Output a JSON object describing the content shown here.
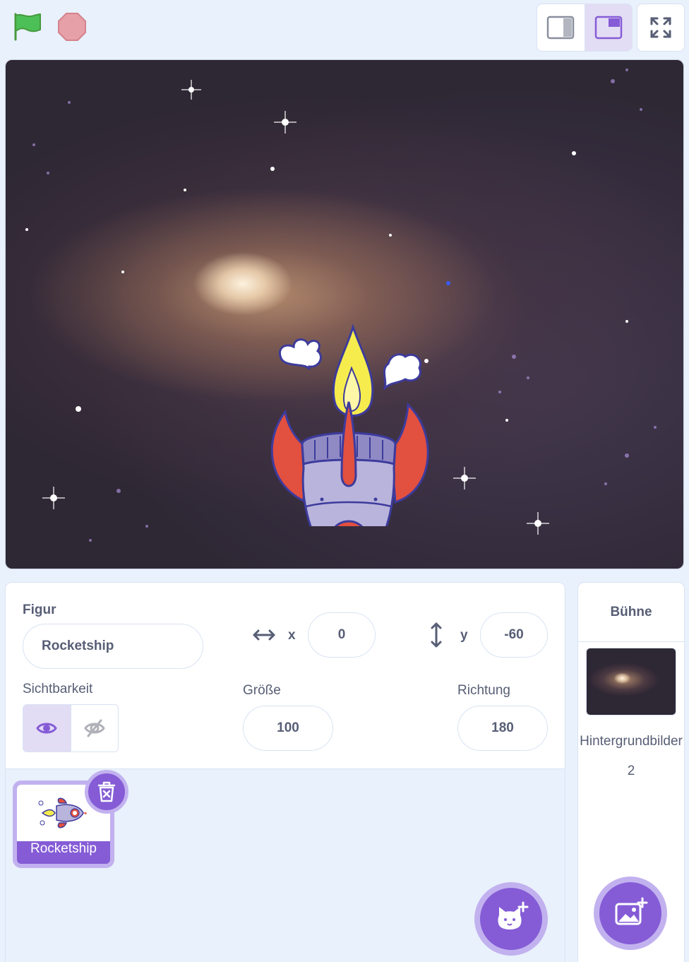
{
  "toolbar": {
    "green_flag_icon": "green-flag-icon",
    "stop_icon": "stop-icon",
    "small_stage_icon": "small-stage-icon",
    "normal_stage_icon": "normal-stage-icon",
    "fullscreen_icon": "fullscreen-icon"
  },
  "stage": {
    "backdrop": "galaxy",
    "sprite": "Rocketship"
  },
  "sprite_info": {
    "sprite_label": "Figur",
    "sprite_name": "Rocketship",
    "x_label": "x",
    "x_value": "0",
    "y_label": "y",
    "y_value": "-60",
    "visibility_label": "Sichtbarkeit",
    "size_label": "Größe",
    "size_value": "100",
    "direction_label": "Richtung",
    "direction_value": "180"
  },
  "sprites": [
    {
      "name": "Rocketship",
      "selected": true
    }
  ],
  "stage_panel": {
    "title": "Bühne",
    "backdrops_label": "Hintergrundbilder",
    "backdrops_count": "2"
  },
  "colors": {
    "accent": "#855cd6",
    "accent_light": "#c2b1ef",
    "background": "#e9f1fc",
    "text": "#575e75",
    "flag_green": "#4cbf56",
    "stop_red": "#e6a0a8"
  }
}
